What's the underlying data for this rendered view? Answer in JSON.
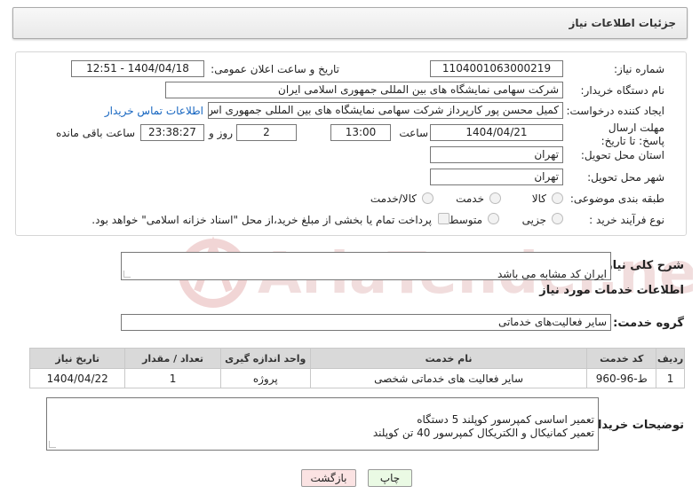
{
  "header": {
    "title": "جزئیات اطلاعات نیاز"
  },
  "form": {
    "need_number_label": "شماره نیاز:",
    "need_number": "1104001063000219",
    "announce_label": "تاریخ و ساعت اعلان عمومی:",
    "announce_value": "1404/04/18 - 12:51",
    "buyer_org_label": "نام دستگاه خریدار:",
    "buyer_org": "شرکت سهامی نمایشگاه های بین المللی جمهوری اسلامی ایران",
    "requester_label": "ایجاد کننده درخواست:",
    "requester": "کمیل محسن پور کارپرداز شرکت سهامی نمایشگاه های بین المللی جمهوری اس",
    "contact_link": "اطلاعات تماس خریدار",
    "deadline_label": "مهلت ارسال پاسخ: تا تاریخ:",
    "deadline_date": "1404/04/21",
    "time_label": "ساعت",
    "deadline_time": "13:00",
    "days_value": "2",
    "days_label": "روز و",
    "remaining_time": "23:38:27",
    "remaining_label": "ساعت باقی مانده",
    "province_label": "استان محل تحویل:",
    "province": "تهران",
    "city_label": "شهر محل تحویل:",
    "city": "تهران",
    "category_label": "طبقه بندی موضوعی:",
    "category_options": [
      "کالا",
      "خدمت",
      "کالا/خدمت"
    ],
    "category_selected": "خدمت",
    "process_label": "نوع فرآیند خرید :",
    "process_options": [
      "جزیی",
      "متوسط"
    ],
    "payment_note": "پرداخت تمام یا بخشی از مبلغ خرید،از محل \"اسناد خزانه اسلامی\" خواهد بود."
  },
  "summary": {
    "label": "شرح کلی نیاز:",
    "value": "ایران کد مشابه می باشد"
  },
  "services": {
    "section_title": "اطلاعات خدمات مورد نیاز",
    "group_label": "گروه خدمت:",
    "group_value": "سایر فعالیت‌های خدماتی",
    "columns": [
      "ردیف",
      "کد خدمت",
      "نام خدمت",
      "واحد اندازه گیری",
      "تعداد / مقدار",
      "تاریخ نیاز"
    ],
    "rows": [
      [
        "1",
        "ط-96-960",
        "سایر فعالیت های خدماتی شخصی",
        "پروژه",
        "1",
        "1404/04/22"
      ]
    ]
  },
  "buyer_notes": {
    "label": "توضیحات خریدار:",
    "value": "تعمیر اساسی کمپرسور کوپلند 5 دستگاه\nتعمیر کمانیکال و الکتریکال کمپرسور 40 تن کوپلند"
  },
  "buttons": {
    "print": "چاپ",
    "back": "بازگشت"
  },
  "watermark": {
    "text": "AriaTender.net"
  },
  "colors": {
    "link": "#1565c0",
    "back_button_bg": "#fbe3e3",
    "print_button_bg": "#eafae4",
    "watermark": "#e8b4b4"
  }
}
